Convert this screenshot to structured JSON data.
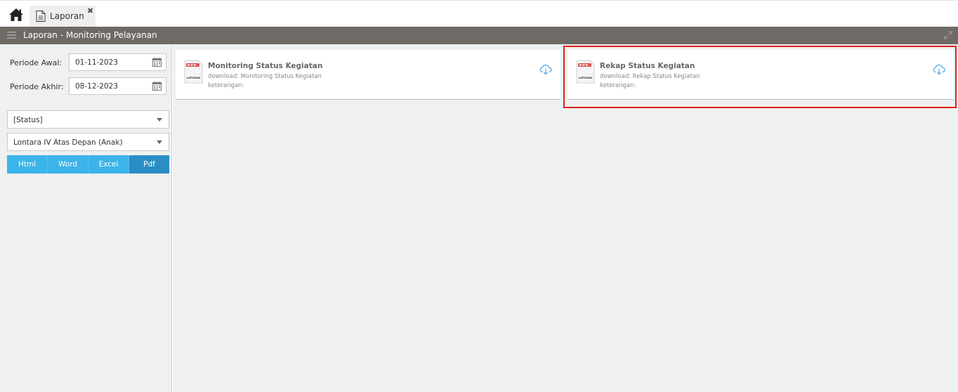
{
  "tabs": [
    {
      "label": "Laporan"
    }
  ],
  "header": {
    "title": "Laporan - Monitoring Pelayanan"
  },
  "filters": {
    "periode_awal_label": "Periode Awal:",
    "periode_awal_value": "01-11-2023",
    "periode_akhir_label": "Periode Akhir:",
    "periode_akhir_value": "08-12-2023",
    "status_value": "[Status]",
    "unit_value": "Lontara IV Atas Depan (Anak)"
  },
  "formats": [
    {
      "label": "Html",
      "active": false
    },
    {
      "label": "Word",
      "active": false
    },
    {
      "label": "Excel",
      "active": false
    },
    {
      "label": "Pdf",
      "active": true
    }
  ],
  "reports": [
    {
      "title": "Monitoring Status Kegiatan",
      "download": "download: Monitoring Status Kegiatan",
      "note": "keterangan:",
      "file_label": "LAPORAN"
    },
    {
      "title": "Rekap Status Kegiatan",
      "download": "download: Rekap Status Kegiatan",
      "note": "keterangan:",
      "file_label": "LAPORAN"
    }
  ],
  "icons": {
    "home": "home-icon",
    "tab": "document-icon",
    "close": "close-icon",
    "menu": "hamburger-icon",
    "expand": "expand-icon",
    "calendar": "calendar-icon",
    "caret": "chevron-down-icon",
    "file": "report-file-icon",
    "download": "cloud-download-icon"
  },
  "colors": {
    "titlebar": "#6f6a65",
    "format_button": "#3bb4ea",
    "format_active": "#2a8ec4",
    "highlight": "#e02020",
    "panel_bg": "#eef1ef"
  }
}
